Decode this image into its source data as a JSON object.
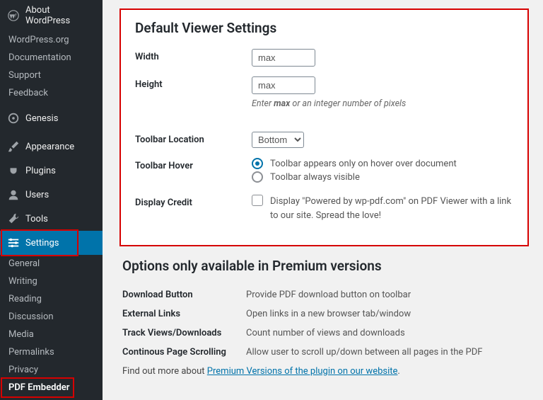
{
  "sidebar": {
    "about": "About WordPress",
    "links": [
      "WordPress.org",
      "Documentation",
      "Support",
      "Feedback"
    ],
    "main": [
      {
        "label": "Genesis",
        "icon": "genesis"
      },
      {
        "label": "Appearance",
        "icon": "brush"
      },
      {
        "label": "Plugins",
        "icon": "plug"
      },
      {
        "label": "Users",
        "icon": "users"
      },
      {
        "label": "Tools",
        "icon": "wrench"
      },
      {
        "label": "Settings",
        "icon": "sliders",
        "active": true
      }
    ],
    "settings_sub": [
      "General",
      "Writing",
      "Reading",
      "Discussion",
      "Media",
      "Permalinks",
      "Privacy",
      "PDF Embedder"
    ]
  },
  "panel1": {
    "heading": "Default Viewer Settings",
    "width_label": "Width",
    "width_value": "max",
    "height_label": "Height",
    "height_value": "max",
    "hint_prefix": "Enter ",
    "hint_bold": "max",
    "hint_suffix": " or an integer number of pixels",
    "toolbar_loc_label": "Toolbar Location",
    "toolbar_loc_value": "Bottom",
    "toolbar_hover_label": "Toolbar Hover",
    "hover_opt1": "Toolbar appears only on hover over document",
    "hover_opt2": "Toolbar always visible",
    "credit_label": "Display Credit",
    "credit_text": "Display \"Powered by wp-pdf.com\" on PDF Viewer with a link to our site. Spread the love!"
  },
  "panel2": {
    "heading": "Options only available in Premium versions",
    "rows": [
      {
        "label": "Download Button",
        "desc": "Provide PDF download button on toolbar"
      },
      {
        "label": "External Links",
        "desc": "Open links in a new browser tab/window"
      },
      {
        "label": "Track Views/Downloads",
        "desc": "Count number of views and downloads"
      },
      {
        "label": "Continous Page Scrolling",
        "desc": "Allow user to scroll up/down between all pages in the PDF"
      }
    ],
    "find_out": "Find out more about ",
    "link_text": "Premium Versions of the plugin on our website",
    "period": "."
  }
}
